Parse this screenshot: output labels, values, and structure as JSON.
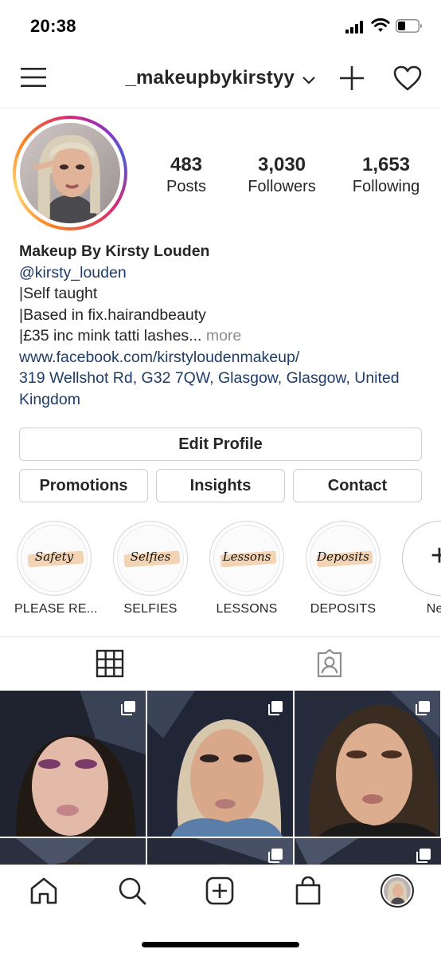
{
  "status_bar": {
    "time": "20:38"
  },
  "header": {
    "username": "_makeupbykirstyy"
  },
  "profile": {
    "stats": [
      {
        "value": "483",
        "label": "Posts"
      },
      {
        "value": "3,030",
        "label": "Followers"
      },
      {
        "value": "1,653",
        "label": "Following"
      }
    ]
  },
  "bio": {
    "name": "Makeup By Kirsty Louden",
    "handle": "@kirsty_louden",
    "line1": "|Self taught",
    "line2": "|Based in fix.hairandbeauty",
    "line3": "|£35 inc mink tatti lashes...",
    "more": "more",
    "website": "www.facebook.com/kirstyloudenmakeup/",
    "address": "319 Wellshot Rd, G32 7QW, Glasgow, Glasgow, United Kingdom"
  },
  "buttons": {
    "edit_profile": "Edit Profile",
    "promotions": "Promotions",
    "insights": "Insights",
    "contact": "Contact"
  },
  "highlights": [
    {
      "cover_text": "Safety",
      "label": "PLEASE RE..."
    },
    {
      "cover_text": "Selfies",
      "label": "SELFIES"
    },
    {
      "cover_text": "Lessons",
      "label": "LESSONS"
    },
    {
      "cover_text": "Deposits",
      "label": "DEPOSITS"
    },
    {
      "cover_text": "+",
      "label": "New"
    }
  ],
  "tabs": [
    "grid-icon",
    "tagged-icon"
  ],
  "bottom_nav": [
    "home-icon",
    "search-icon",
    "add-post-icon",
    "shop-icon",
    "profile-avatar"
  ],
  "colors": {
    "link": "#1f3d68",
    "muted": "#8e8e8e",
    "text": "#262626",
    "highlight_stroke": "#f2d3b4"
  }
}
